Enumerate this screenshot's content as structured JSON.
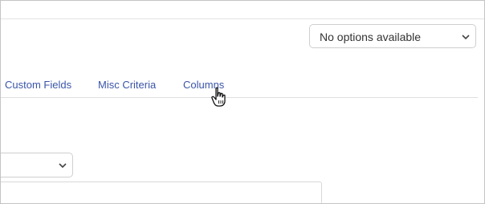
{
  "header": {
    "options_select": {
      "value": "No options available"
    }
  },
  "tabs": [
    {
      "label": "Custom Fields"
    },
    {
      "label": "Misc Criteria"
    },
    {
      "label": "Columns"
    }
  ],
  "colors": {
    "link": "#3a55a8",
    "border": "#cfcfcf"
  },
  "icons": {
    "dropdown": "chevron-down-icon",
    "cursor": "hand-pointer-icon"
  }
}
